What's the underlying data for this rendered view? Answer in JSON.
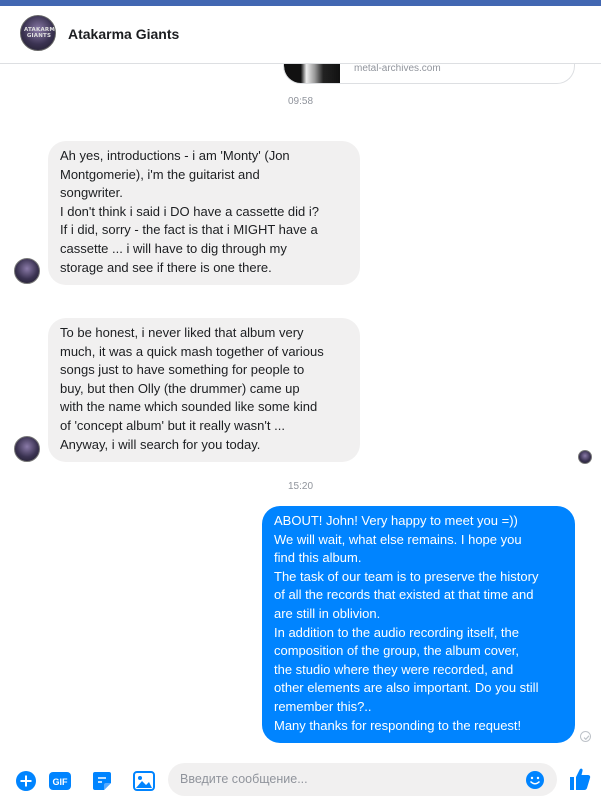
{
  "header": {
    "title": "Atakarma Giants",
    "avatar_logo_text": "ATAKARMA GIANTS"
  },
  "shared_link": {
    "domain": "metal-archives.com"
  },
  "timestamps": [
    "09:58",
    "15:20"
  ],
  "messages": [
    {
      "direction": "incoming",
      "text": "Ah yes, introductions - i am 'Monty' (Jon\nMontgomerie), i'm the guitarist and\nsongwriter.\nI don't think i said i DO have a cassette did i?\nIf i did, sorry - the fact is that i MIGHT have a\ncassette ... i will have to dig through my\nstorage and see if there is one there."
    },
    {
      "direction": "incoming",
      "text": "To be honest, i never liked that album very\nmuch, it was a quick mash together of various\nsongs just to have something for people to\nbuy, but then Olly (the drummer) came up\nwith the name which sounded like some kind\nof 'concept album' but it really wasn't ...\nAnyway, i will search for you today."
    },
    {
      "direction": "outgoing",
      "text": "ABOUT! John! Very happy to meet you =))\nWe will wait, what else remains. I hope you\nfind this album.\nThe task of our team is to preserve the history\nof all the records that existed at that time and\nare still in oblivion.\nIn addition to the audio recording itself, the\ncomposition of the group, the album cover,\nthe studio where they were recorded, and\nother elements are also important. Do you still\nremember this?..\nMany thanks for responding to the request!"
    }
  ],
  "composer": {
    "placeholder": "Введите сообщение..."
  },
  "colors": {
    "brand_blue": "#4267b2",
    "messenger_blue": "#0084ff",
    "incoming_bubble": "#f1f0f0",
    "like_blue": "#0084ff"
  }
}
